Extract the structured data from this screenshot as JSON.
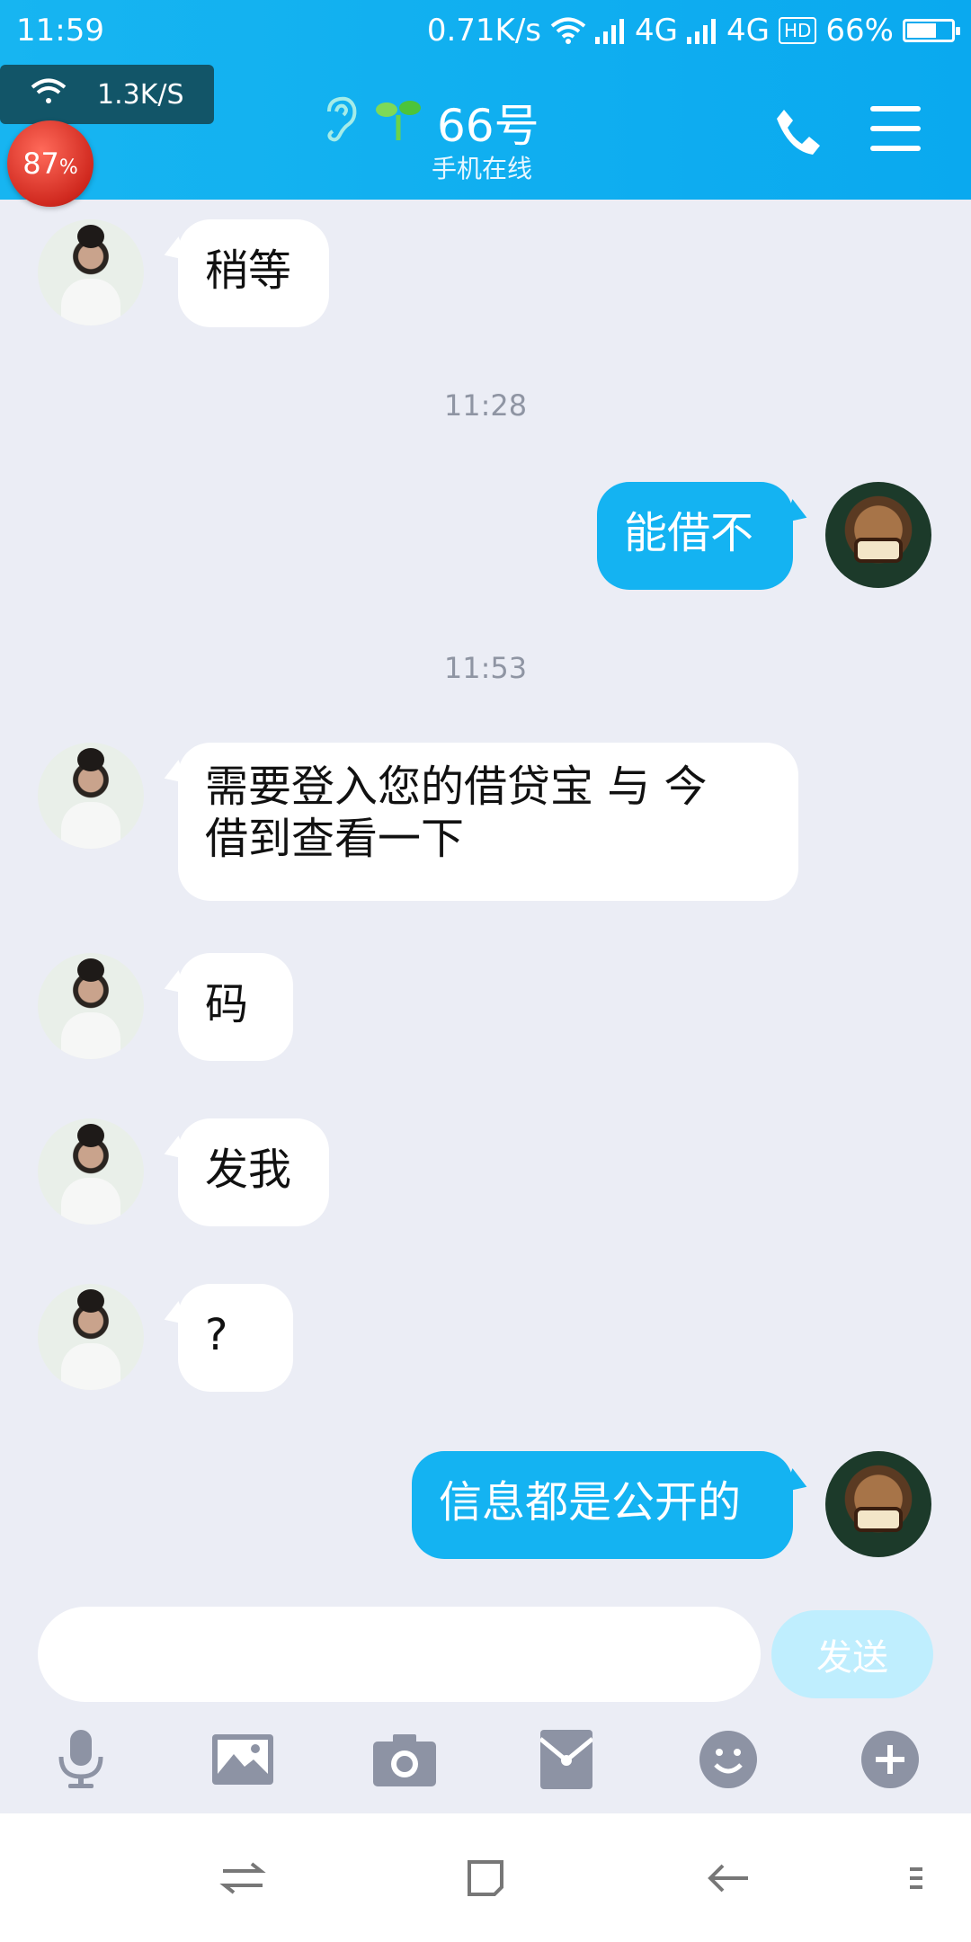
{
  "status_bar": {
    "time": "11:59",
    "net_speed": "0.71K/s",
    "network_1": "4G",
    "network_2": "4G",
    "hd_badge": "HD",
    "battery_pct": "66%",
    "battery_level": 0.66
  },
  "overlay": {
    "wifi_speed": "1.3K/S",
    "memory_ball": "87",
    "memory_pct_sign": "%"
  },
  "header": {
    "contact_name": "66号",
    "contact_status": "手机在线"
  },
  "messages": [
    {
      "side": "in",
      "text": "稍等"
    },
    {
      "timestamp": "11:28"
    },
    {
      "side": "out",
      "text": "能借不"
    },
    {
      "timestamp": "11:53"
    },
    {
      "side": "in",
      "text_line1": "需要登入您的借贷宝 与 今",
      "text_line2": "借到查看一下"
    },
    {
      "side": "in",
      "text": "码"
    },
    {
      "side": "in",
      "text": "发我"
    },
    {
      "side": "in",
      "text": "?"
    },
    {
      "side": "out",
      "text": "信息都是公开的"
    }
  ],
  "composer": {
    "input_value": "",
    "send_label": "发送"
  },
  "toolbar_icons": [
    "microphone-icon",
    "image-icon",
    "camera-icon",
    "red-envelope-icon",
    "emoji-icon",
    "plus-icon"
  ],
  "colors": {
    "header": "#0aa9ef",
    "out_bubble": "#14b3f2",
    "in_bubble": "#ffffff",
    "chat_bg": "#ebedf5",
    "send_disabled": "#bfeefe",
    "toolbar_icon": "#8d93a4"
  }
}
